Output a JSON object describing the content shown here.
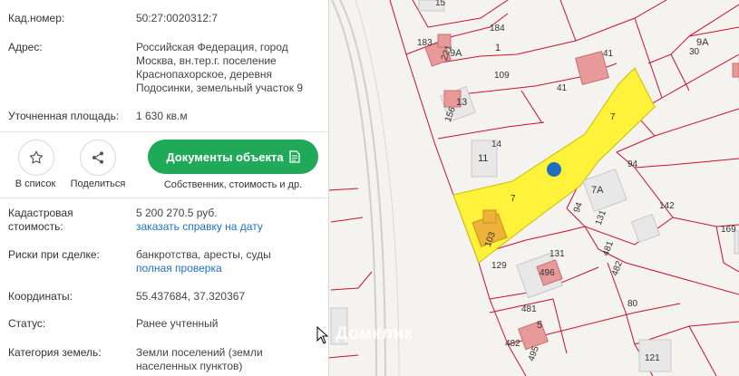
{
  "panel": {
    "cad_number": {
      "label": "Кад.номер:",
      "value": "50:27:0020312:7"
    },
    "address": {
      "label": "Адрес:",
      "lines": [
        "Российская Федерация, город",
        "Москва, вн.тер.г. поселение",
        "Краснопахорское, деревня",
        "Подосинки, земельный участок 9"
      ]
    },
    "area": {
      "label": "Уточненная площадь:",
      "value": "1 630 кв.м"
    },
    "actions": {
      "favorite": "В список",
      "share": "Поделиться"
    },
    "docs": {
      "button": "Документы объекта",
      "subtitle": "Собственник, стоимость и др."
    },
    "cad_cost": {
      "label_line1": "Кадастровая",
      "label_line2": "стоимость:",
      "value": "5 200 270.5 руб.",
      "link": "заказать справку на дату"
    },
    "risks": {
      "label": "Риски при сделке:",
      "value": "банкротства, аресты, суды",
      "link": "полная проверка"
    },
    "coords": {
      "label": "Координаты:",
      "value": "55.437684, 37.320367"
    },
    "status": {
      "label": "Статус:",
      "value": "Ранее учтенный"
    },
    "category": {
      "label": "Категория земель:",
      "value_line1": "Земли поселений (земли",
      "value_line2": "населенных пунктов)"
    }
  },
  "map": {
    "watermark": "Домклик",
    "highlight_color": "#fff23a",
    "boundary_color": "#c8102e",
    "marker_color": "#1e6fbf",
    "labels": {
      "l15": "15",
      "l183": "183",
      "l184": "184",
      "l9a_small": "9А",
      "l221": "221",
      "l1": "1",
      "l41a": "41",
      "l9A": "9А",
      "l30": "30",
      "l109": "109",
      "l41b": "41",
      "l13": "13",
      "l156": "156",
      "l7a": "7",
      "l14": "14",
      "l11": "11",
      "l94a": "94",
      "l7A": "7А",
      "l7b": "7",
      "l142": "142",
      "l94b": "94",
      "l131a": "131",
      "l169": "169",
      "l103": "103",
      "l129": "129",
      "l131b": "131",
      "l481a": "481",
      "l496": "496",
      "l482a": "482",
      "l80": "80",
      "l481b": "481",
      "l5": "5",
      "l482b": "482",
      "l495": "495",
      "l121": "121"
    }
  }
}
